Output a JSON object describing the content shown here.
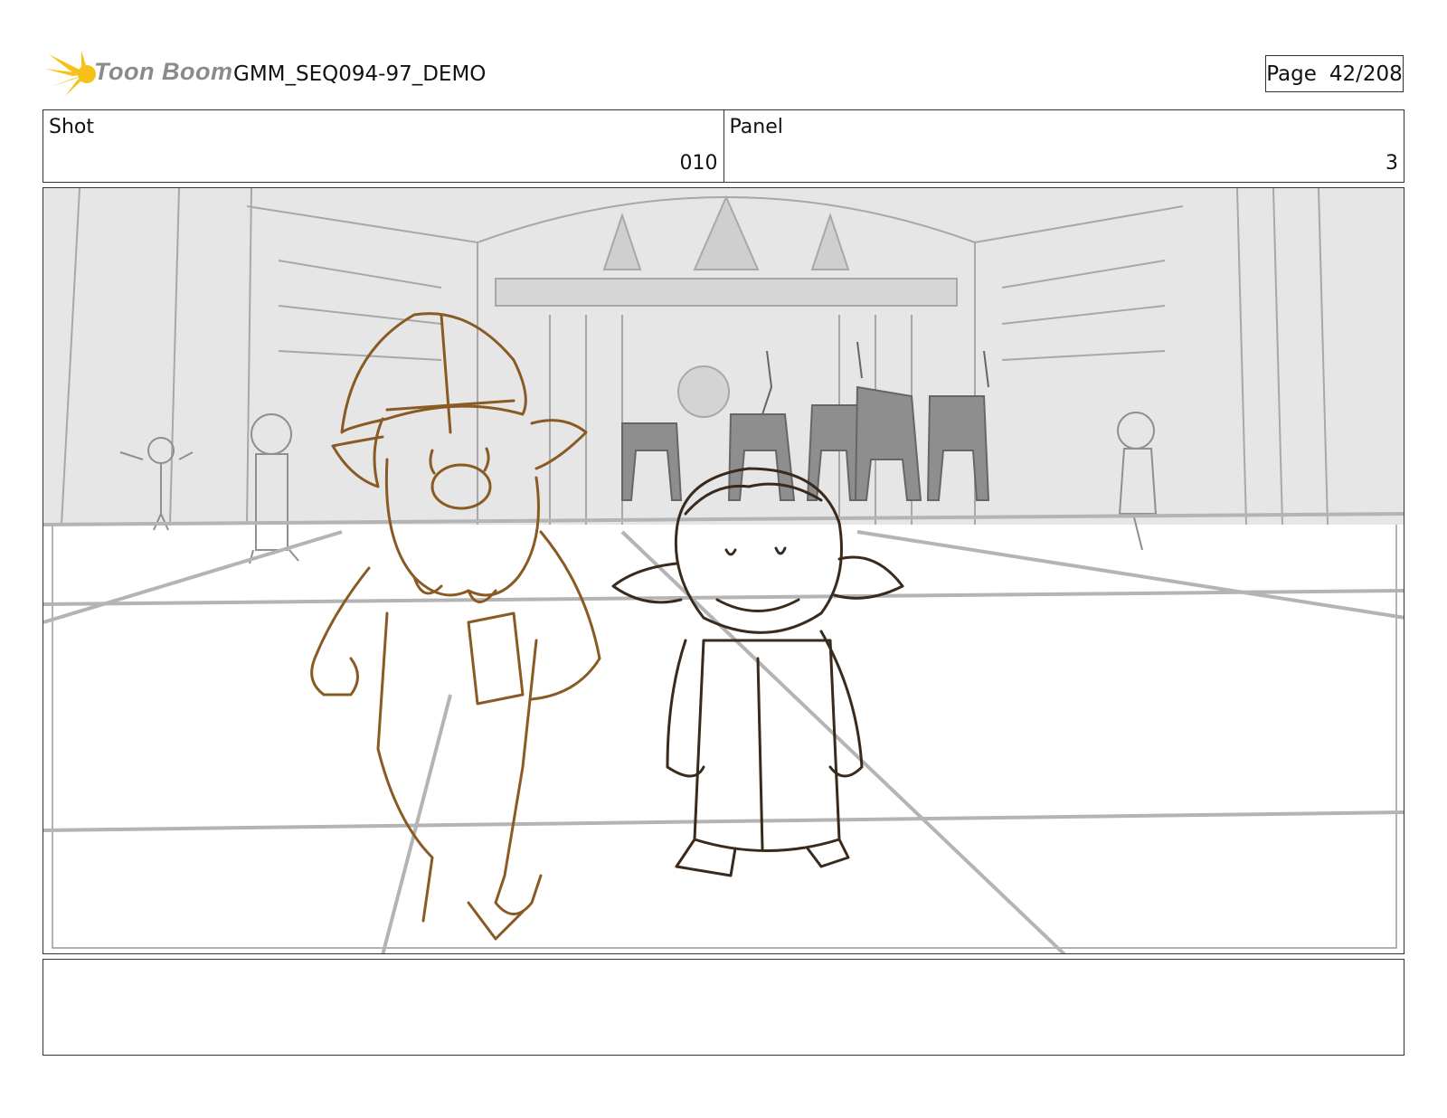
{
  "header": {
    "brand": "Toon Boom",
    "document_title": "GMM_SEQ094-97_DEMO",
    "page_label": "Page",
    "page_number": "42/208"
  },
  "info": {
    "shot_label": "Shot",
    "shot_value": "010",
    "panel_label": "Panel",
    "panel_value": "3"
  },
  "notes": {
    "text": ""
  },
  "colors": {
    "logo_yellow": "#f6c21a",
    "sketch_brown": "#8a5a24",
    "sketch_dark": "#3a2a1c",
    "background_gray": "#b8b8b8"
  }
}
